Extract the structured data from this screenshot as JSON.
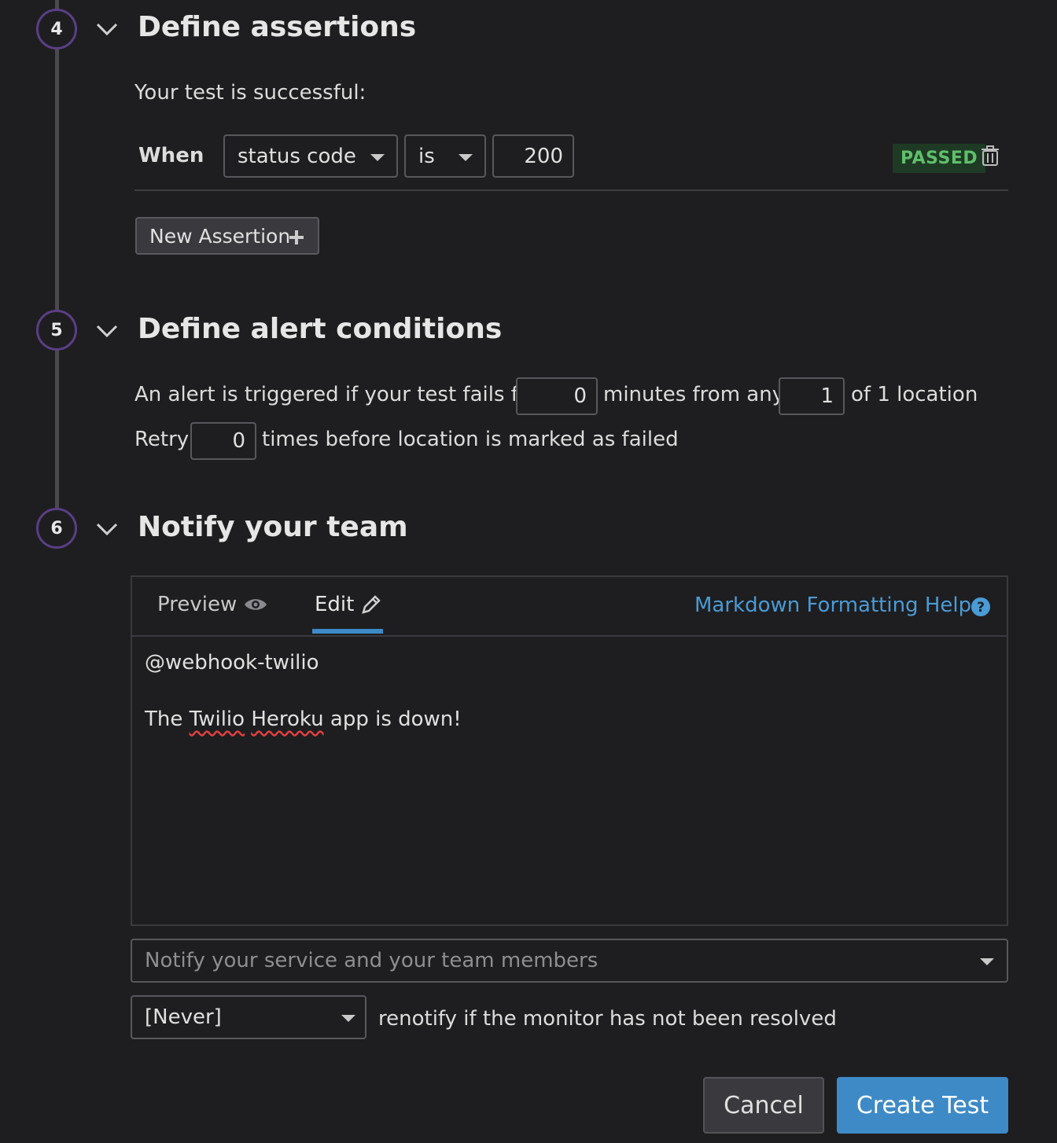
{
  "steps": [
    {
      "number": "4",
      "title": "Define assertions"
    },
    {
      "number": "5",
      "title": "Define alert conditions"
    },
    {
      "number": "6",
      "title": "Notify your team"
    }
  ],
  "assertions": {
    "intro": "Your test is successful:",
    "when_label": "When",
    "field_value": "status code",
    "operator_value": "is",
    "target_value": "200",
    "status": "PASSED",
    "new_assertion_label": "New Assertion"
  },
  "alert": {
    "text_before_minutes": "An alert is triggered if your test fails for",
    "minutes_value": "0",
    "text_after_minutes": "minutes from any",
    "locations_value": "1",
    "text_after_locations": "of 1 location",
    "retry_label": "Retry",
    "retry_value": "0",
    "retry_suffix": "times before location is marked as failed"
  },
  "notify": {
    "tab_preview": "Preview",
    "tab_edit": "Edit",
    "help_link": "Markdown Formatting Help",
    "message_line1": "@webhook-twilio",
    "message_line2_pre": "The ",
    "message_word1": "Twilio",
    "message_space": " ",
    "message_word2": "Heroku",
    "message_line2_post": " app is down!",
    "recipients_placeholder": "Notify your service and your team members",
    "renotify_value": "[Never]",
    "renotify_text": "renotify if the monitor has not been resolved"
  },
  "actions": {
    "cancel_label": "Cancel",
    "create_label": "Create Test"
  },
  "colors": {
    "background": "#1e1e20",
    "step_ring": "#5a3e86",
    "passed_text": "#5fbf6a",
    "link": "#4a9bd6",
    "primary_button": "#3d8ac6",
    "active_tab": "#3d8ac6"
  }
}
